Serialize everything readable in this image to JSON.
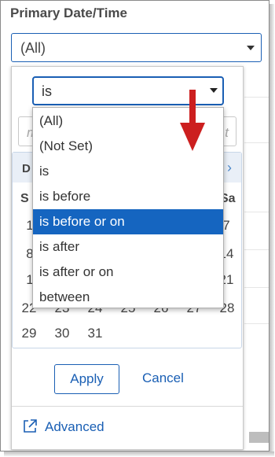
{
  "filter": {
    "title": "Primary Date/Time",
    "selected_value": "(All)"
  },
  "operator": {
    "selected": "is",
    "options": [
      "(All)",
      "(Not Set)",
      "is",
      "is before",
      "is before or on",
      "is after",
      "is after or on",
      "between"
    ],
    "highlighted_index": 4
  },
  "date_input": {
    "placeholder_left": "m",
    "placeholder_right": "t"
  },
  "calendar": {
    "month_partial": "D",
    "next_glyph": "›",
    "dow_first": "S",
    "dow_last": "Sa",
    "visible_days": {
      "r1_left": "1",
      "r1_right": "7",
      "r2_left": "8",
      "r2_right": "14",
      "r3_left": "1",
      "r3_right": "21",
      "r4": [
        "22",
        "23",
        "24",
        "25",
        "26",
        "27",
        "28"
      ],
      "r5": [
        "29",
        "30",
        "31"
      ]
    }
  },
  "buttons": {
    "apply": "Apply",
    "cancel": "Cancel",
    "advanced": "Advanced"
  },
  "colors": {
    "accent": "#1a5fb4",
    "highlight": "#1565c0",
    "annotation_arrow": "#cc1f1f"
  }
}
